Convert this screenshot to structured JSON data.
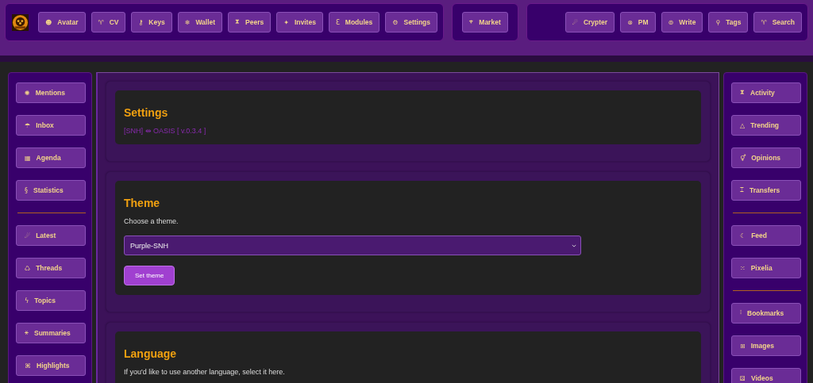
{
  "top_nav": {
    "groups": [
      [
        {
          "icon": "☻",
          "label": "Avatar"
        },
        {
          "icon": "♈",
          "label": "CV"
        },
        {
          "icon": "⚷",
          "label": "Keys"
        },
        {
          "icon": "❄",
          "label": "Wallet"
        },
        {
          "icon": "⧗",
          "label": "Peers"
        },
        {
          "icon": "✦",
          "label": "Invites"
        },
        {
          "icon": "Ɛ",
          "label": "Modules"
        },
        {
          "icon": "⚙",
          "label": "Settings"
        }
      ],
      [
        {
          "icon": "⌖",
          "label": "Market"
        }
      ],
      [
        {
          "icon": "☄",
          "label": "Crypter"
        },
        {
          "icon": "⊗",
          "label": "PM"
        },
        {
          "icon": "⊚",
          "label": "Write"
        },
        {
          "icon": "⚲",
          "label": "Tags"
        },
        {
          "icon": "♈",
          "label": "Search"
        }
      ]
    ]
  },
  "left_sidebar": {
    "groups": [
      [
        {
          "icon": "✺",
          "label": "Mentions"
        },
        {
          "icon": "☂",
          "label": "Inbox"
        },
        {
          "icon": "▦",
          "label": "Agenda"
        },
        {
          "icon": "§",
          "label": "Statistics"
        }
      ],
      [
        {
          "icon": "☄",
          "label": "Latest"
        },
        {
          "icon": "♺",
          "label": "Threads"
        },
        {
          "icon": "ϟ",
          "label": "Topics"
        },
        {
          "icon": "⚹",
          "label": "Summaries"
        },
        {
          "icon": "⌘",
          "label": "Highlights"
        }
      ]
    ]
  },
  "main": {
    "sections": [
      {
        "title": "Settings",
        "subtitle": "[SNH] ⇹ OASIS [ v.0.3.4 ]"
      },
      {
        "title": "Theme",
        "description": "Choose a theme.",
        "select_value": "Purple-SNH",
        "button": "Set theme"
      },
      {
        "title": "Language",
        "description": "If you'd like to use another language, select it here."
      }
    ]
  },
  "right_sidebar": {
    "groups": [
      [
        {
          "icon": "⧗",
          "label": "Activity"
        },
        {
          "icon": "△",
          "label": "Trending"
        },
        {
          "icon": "⚥",
          "label": "Opinions"
        },
        {
          "icon": "⌶",
          "label": "Transfers"
        }
      ],
      [
        {
          "icon": "☾",
          "label": "Feed"
        },
        {
          "icon": "⁙",
          "label": "Pixelia"
        }
      ],
      [
        {
          "icon": "⫶",
          "label": "Bookmarks"
        },
        {
          "icon": "⊞",
          "label": "Images"
        },
        {
          "icon": "⚄",
          "label": "Videos"
        }
      ]
    ]
  }
}
